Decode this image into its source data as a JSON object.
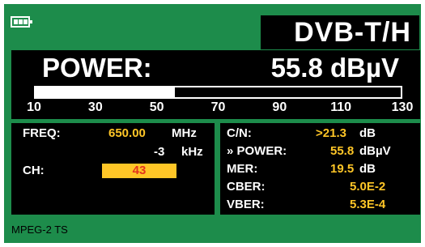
{
  "header": {
    "battery_icon": "battery-full-icon",
    "standard": "DVB-T/H"
  },
  "measurement": {
    "label": "POWER:",
    "value": "55.8 dBµV",
    "bar_level_dbuv": 55.8,
    "scale_min": 10,
    "scale_max": 130
  },
  "scale": {
    "ticks": [
      "10",
      "30",
      "50",
      "70",
      "90",
      "110",
      "130"
    ]
  },
  "tuning": {
    "freq_label": "FREQ:",
    "freq_value": "650.00",
    "freq_unit": "MHz",
    "offset_value": "-3",
    "offset_unit": "kHz",
    "ch_label": "CH:",
    "ch_value": "43"
  },
  "quality": {
    "cn_label": "C/N:",
    "cn_value": ">21.3",
    "cn_unit": "dB",
    "power_label": "» POWER:",
    "power_value": "55.8",
    "power_unit": "dBµV",
    "mer_label": "MER:",
    "mer_value": "19.5",
    "mer_unit": "dB",
    "cber_label": "CBER:",
    "cber_value": "5.0E-2",
    "vber_label": "VBER:",
    "vber_value": "5.3E-4"
  },
  "status": {
    "text": "MPEG-2 TS"
  },
  "colors": {
    "background": "#1d8c4b",
    "panel": "#000000",
    "accent": "#ffc627",
    "channel_text": "#e3341e"
  }
}
